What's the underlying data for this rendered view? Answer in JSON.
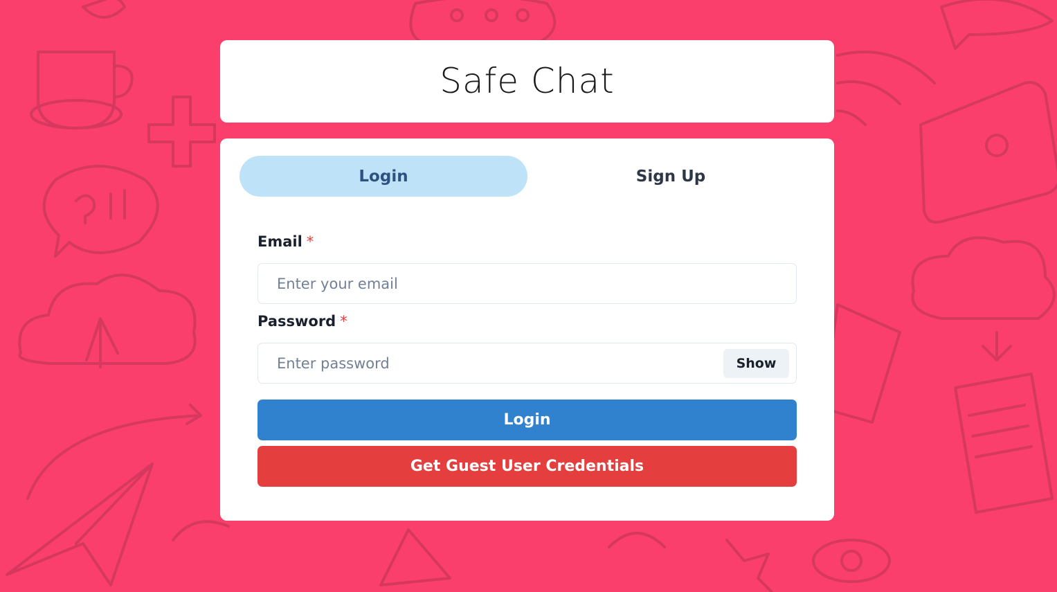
{
  "colors": {
    "background": "#fb3f6c",
    "doodle": "#c93758",
    "tab_active_bg": "#bee3f8",
    "primary": "#3182ce",
    "danger": "#e53e3e"
  },
  "header": {
    "title": "Safe Chat"
  },
  "tabs": [
    {
      "label": "Login",
      "active": true
    },
    {
      "label": "Sign Up",
      "active": false
    }
  ],
  "form": {
    "email": {
      "label": "Email",
      "required_mark": "*",
      "placeholder": "Enter your email",
      "value": ""
    },
    "password": {
      "label": "Password",
      "required_mark": "*",
      "placeholder": "Enter password",
      "value": "",
      "toggle_label": "Show"
    },
    "submit_label": "Login",
    "guest_label": "Get Guest User Credentials"
  }
}
